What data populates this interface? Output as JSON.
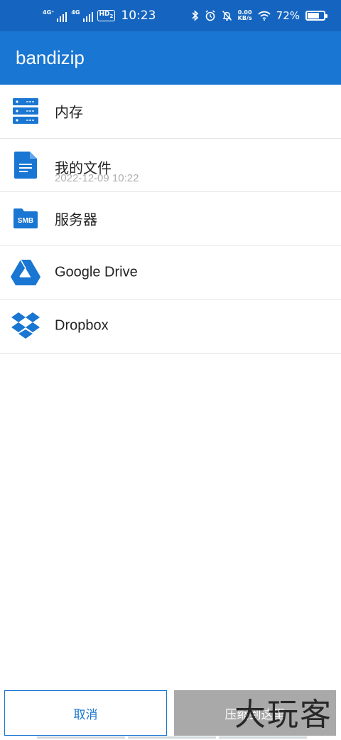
{
  "status_bar": {
    "sim1_label": "4G⁺",
    "sim2_label": "4G",
    "hd_label": "HD",
    "hd_sub": "2",
    "time": "10:23",
    "net_speed_value": "0.00",
    "net_speed_unit": "KB/s",
    "battery_percent": "72%",
    "battery_level": 0.72
  },
  "app_bar": {
    "title": "bandizip"
  },
  "list": {
    "items": [
      {
        "label": "内存",
        "icon": "storage-icon"
      },
      {
        "label": "我的文件",
        "sub": "2022-12-09 10:22",
        "icon": "document-icon"
      },
      {
        "label": "服务器",
        "icon": "smb-server-icon",
        "icon_text": "SMB"
      },
      {
        "label": "Google Drive",
        "icon": "google-drive-icon"
      },
      {
        "label": "Dropbox",
        "icon": "dropbox-icon"
      }
    ]
  },
  "bottom": {
    "cancel_label": "取消",
    "compress_label": "压缩到这里"
  },
  "watermark": "大玩客",
  "colors": {
    "status_bar": "#1565c0",
    "app_bar": "#1976d2",
    "icon_blue": "#1976d2",
    "disabled_button": "#a9a9a9"
  }
}
